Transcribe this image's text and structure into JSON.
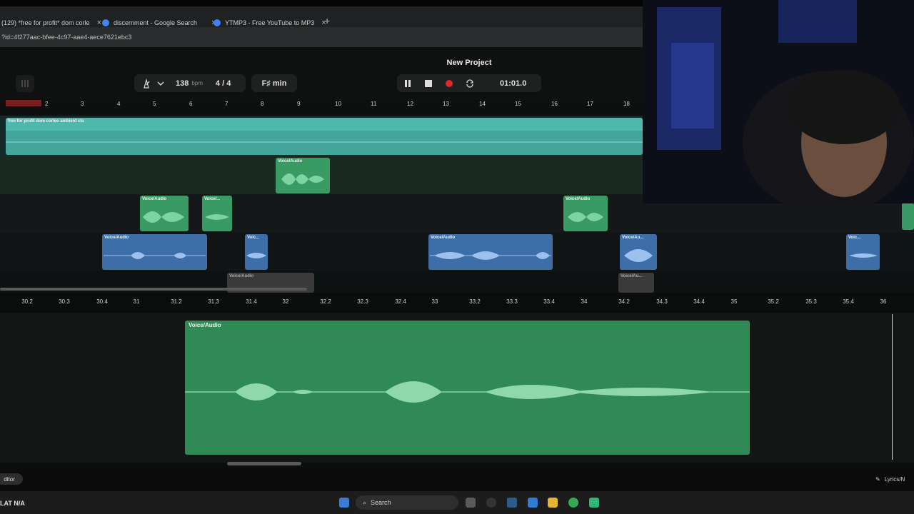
{
  "browser": {
    "tabs": [
      {
        "title": "(129) *free for profit* dom corle",
        "close": "×",
        "color": "#d93025"
      },
      {
        "title": "discernment - Google Search",
        "close": "×",
        "color": "#4285f4"
      },
      {
        "title": "YTMP3 - Free YouTube to MP3",
        "close": "×",
        "color": "#3b82f6"
      }
    ],
    "new_tab": "+",
    "url": "?id=4f277aac-bfee-4c97-aae4-aece7621ebc3"
  },
  "app": {
    "project_title": "New Project",
    "tempo": "138",
    "tempo_unit": "bpm",
    "time_signature": "4 / 4",
    "key": "F♯ min",
    "time_display": "01:01.0",
    "ruler_numbers": [
      "1",
      "2",
      "3",
      "4",
      "5",
      "6",
      "7",
      "8",
      "9",
      "10",
      "11",
      "12",
      "13",
      "14",
      "15",
      "16",
      "17",
      "18"
    ],
    "track1_clip_label": "free for profit dom corleo  ambient  clu",
    "clip_label": "Voice/Audio",
    "clip_label_short1": "Voice/...",
    "clip_label_short2": "Voic...",
    "clip_label_short3": "Voice/Au...",
    "lower_ruler": [
      "30.2",
      "30.3",
      "30.4",
      "31",
      "31.2",
      "31.3",
      "31.4",
      "32",
      "32.2",
      "32.3",
      "32.4",
      "33",
      "33.2",
      "33.3",
      "33.4",
      "34",
      "34.2",
      "34.3",
      "34.4",
      "35",
      "35.2",
      "35.3",
      "35.4",
      "36"
    ],
    "editor_clip_label": "Voice/Audio",
    "editor_button": "ditor",
    "lyrics_button": "Lyrics/N"
  },
  "taskbar": {
    "weather": "LAT  N/A",
    "search_placeholder": "Search"
  },
  "colors": {
    "teal_clip": "#4fb8ad",
    "green_clip": "#3a9a63",
    "blue_clip": "#3e6ea8",
    "record": "#e0282b"
  }
}
